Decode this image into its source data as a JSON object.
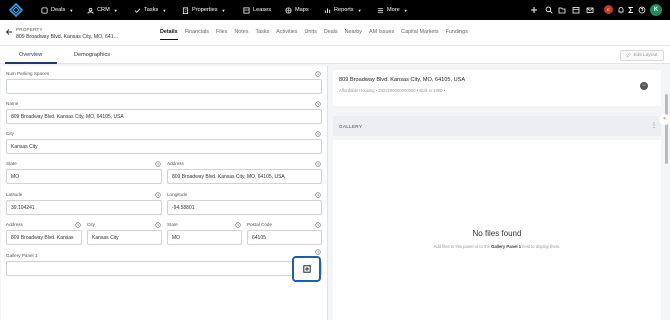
{
  "nav": {
    "items": [
      {
        "label": "Deals"
      },
      {
        "label": "CRM"
      },
      {
        "label": "Tasks"
      },
      {
        "label": "Properties"
      },
      {
        "label": "Leases"
      },
      {
        "label": "Maps"
      },
      {
        "label": "Reports"
      },
      {
        "label": "More"
      }
    ],
    "avatar_initial": "K",
    "notif_initial": "E"
  },
  "breadcrumb": {
    "label": "PROPERTY",
    "title": "809 Broadway Blvd. Kansas City, MO, 641..."
  },
  "record_tabs": [
    "Details",
    "Financials",
    "Files",
    "Notes",
    "Tasks",
    "Activities",
    "Units",
    "Deals",
    "Nearby",
    "AM Issues",
    "Capital Markets",
    "Fundings"
  ],
  "record_tabs_active": "Details",
  "section_tabs": {
    "overview": "Overview",
    "demographics": "Demographics"
  },
  "edit_layout": "Edit Layout",
  "form": {
    "num_parking_label": "Num Parking Spaces",
    "num_parking_value": "",
    "name_label": "Name",
    "name_value": "809 Broadway Blvd. Kansas City, MO, 64105, USA",
    "city_label": "City",
    "city_value": "Kansas City",
    "state_label": "State",
    "state_value": "MO",
    "address_label": "Address",
    "address_value": "809 Broadway Blvd. Kansas City, MO, 64105, USA",
    "latitude_label": "Latitude",
    "latitude_value": "39.104241",
    "longitude_label": "Longitude",
    "longitude_value": "-94.58801",
    "address2_label": "Address",
    "address2_value": "809 Broadway Blvd. Kansas",
    "city2_label": "City",
    "city2_value": "Kansas City",
    "state2_label": "State",
    "state2_value": "MO",
    "postal_label": "Postal Code",
    "postal_value": "64105",
    "gallery_label": "Gallery Panel 1"
  },
  "property_card": {
    "title": "809 Broadway Blvd. Kansas City, MO, 64105, USA",
    "subtitle": "Affordable Housing • 2922200000000000 • Built in 1900 •"
  },
  "gallery": {
    "header": "GALLERY",
    "empty_title": "No files found",
    "empty_sub_pre": "Add files to this panel or to the ",
    "empty_sub_bold": "Gallery Panel 1",
    "empty_sub_post": " field to display them."
  }
}
